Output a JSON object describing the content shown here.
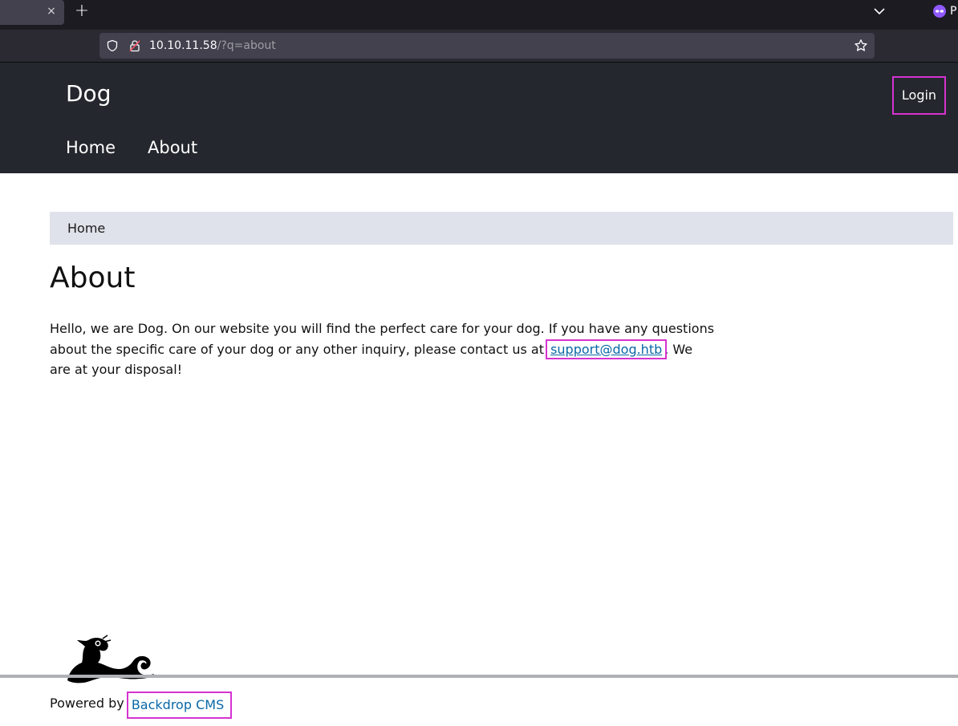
{
  "browser": {
    "tab_close": "×",
    "new_tab": "+",
    "private_label": "P",
    "url_host": "10.10.11.58",
    "url_path": "/?q=about"
  },
  "header": {
    "site_name": "Dog",
    "login_label": "Login",
    "menu": [
      {
        "label": "Home"
      },
      {
        "label": "About"
      }
    ]
  },
  "breadcrumb": {
    "home": "Home"
  },
  "main": {
    "title": "About",
    "text_before": "Hello, we are Dog. On our website you will find the perfect care for your dog. If you have any questions about the specific care of your dog or any other inquiry, please contact us at ",
    "email": "support@dog.htb",
    "text_after": ". We are at your disposal!"
  },
  "footer": {
    "powered_by": "Powered by ",
    "cms_link": "Backdrop CMS"
  },
  "colors": {
    "header_bg": "#24272d",
    "breadcrumb_bg": "#dfe2ea",
    "link": "#0a67a8",
    "highlight": "#d633d1"
  }
}
